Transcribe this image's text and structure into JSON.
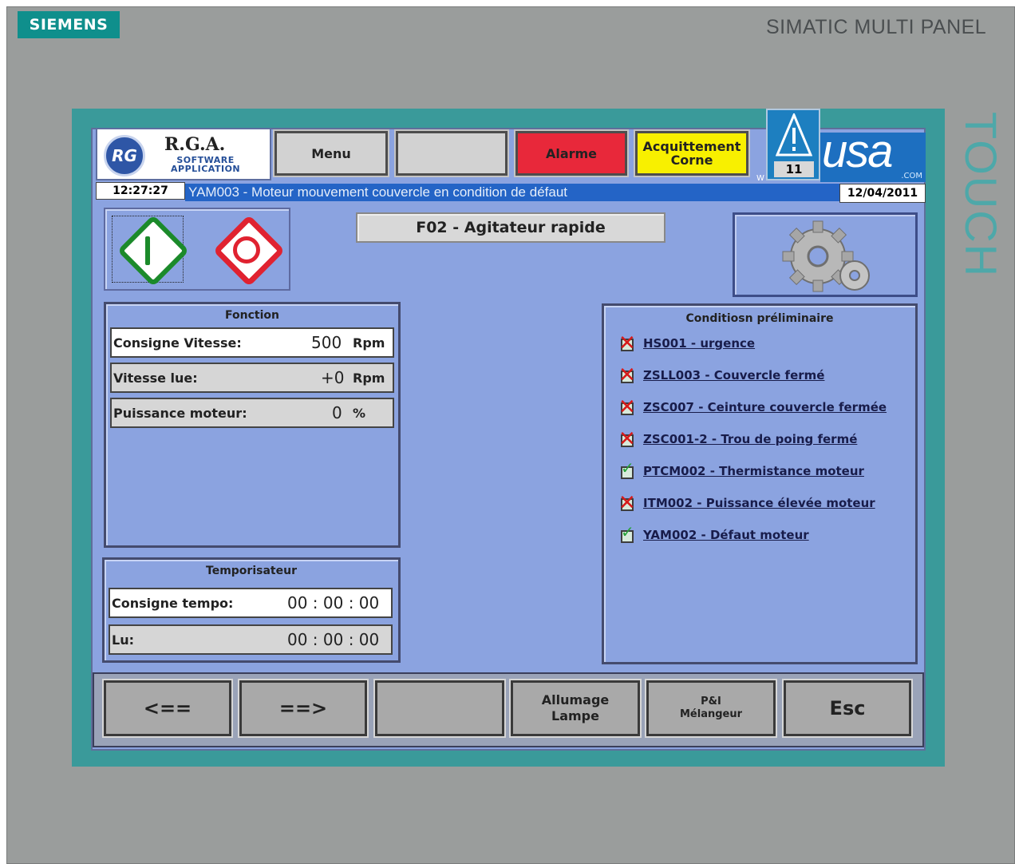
{
  "device": {
    "brand": "SIEMENS",
    "model": "SIMATIC MULTI PANEL",
    "side_label": "TOUCH"
  },
  "header": {
    "logo_title": "R.G.A.",
    "logo_sub1": "Software",
    "logo_sub2": "Application",
    "menu_label": "Menu",
    "blank_label": "",
    "alarm_label": "Alarme",
    "ack_label": "Acquittement Corne",
    "alarm_count": "11",
    "alarm_w": "W",
    "usa_text": "usa",
    "usa_com": ".COM",
    "time": "12:27:27",
    "message": "YAM003 - Moteur mouvement couvercle en condition de défaut",
    "date": "12/04/2011"
  },
  "main": {
    "title": "F02 - Agitateur rapide"
  },
  "fonction": {
    "title": "Fonction",
    "rows": [
      {
        "label": "Consigne Vitesse:",
        "value": "500",
        "unit": "Rpm"
      },
      {
        "label": "Vitesse lue:",
        "value": "+0",
        "unit": "Rpm"
      },
      {
        "label": "Puissance moteur:",
        "value": "0",
        "unit": "%"
      }
    ]
  },
  "temporisateur": {
    "title": "Temporisateur",
    "rows": [
      {
        "label": "Consigne tempo:",
        "value": "00 : 00 : 00"
      },
      {
        "label": "Lu:",
        "value": "00 : 00 : 00"
      }
    ]
  },
  "conditions": {
    "title": "Conditiosn préliminaire",
    "items": [
      {
        "label": "HS001 - urgence",
        "ok": false
      },
      {
        "label": "ZSLL003 - Couvercle fermé",
        "ok": false
      },
      {
        "label": "ZSC007 - Ceinture couvercle fermée",
        "ok": false
      },
      {
        "label": "ZSC001-2 - Trou de poing fermé",
        "ok": false
      },
      {
        "label": "PTCM002 - Thermistance moteur",
        "ok": true
      },
      {
        "label": "ITM002 - Puissance élevée moteur",
        "ok": false
      },
      {
        "label": "YAM002 - Défaut moteur",
        "ok": true
      }
    ]
  },
  "footer": {
    "buttons": [
      {
        "label": "<=="
      },
      {
        "label": "==>"
      },
      {
        "label": ""
      },
      {
        "label": "Allumage Lampe"
      },
      {
        "label": "P&I Mélangeur"
      },
      {
        "label": "Esc"
      }
    ]
  },
  "colors": {
    "screen_bg": "#8ba3e0",
    "alarm": "#e8283a",
    "ack": "#f8f000",
    "message_bar": "#2464c6",
    "ok_green": "#27a23a",
    "fault_red": "#d61a1a"
  }
}
